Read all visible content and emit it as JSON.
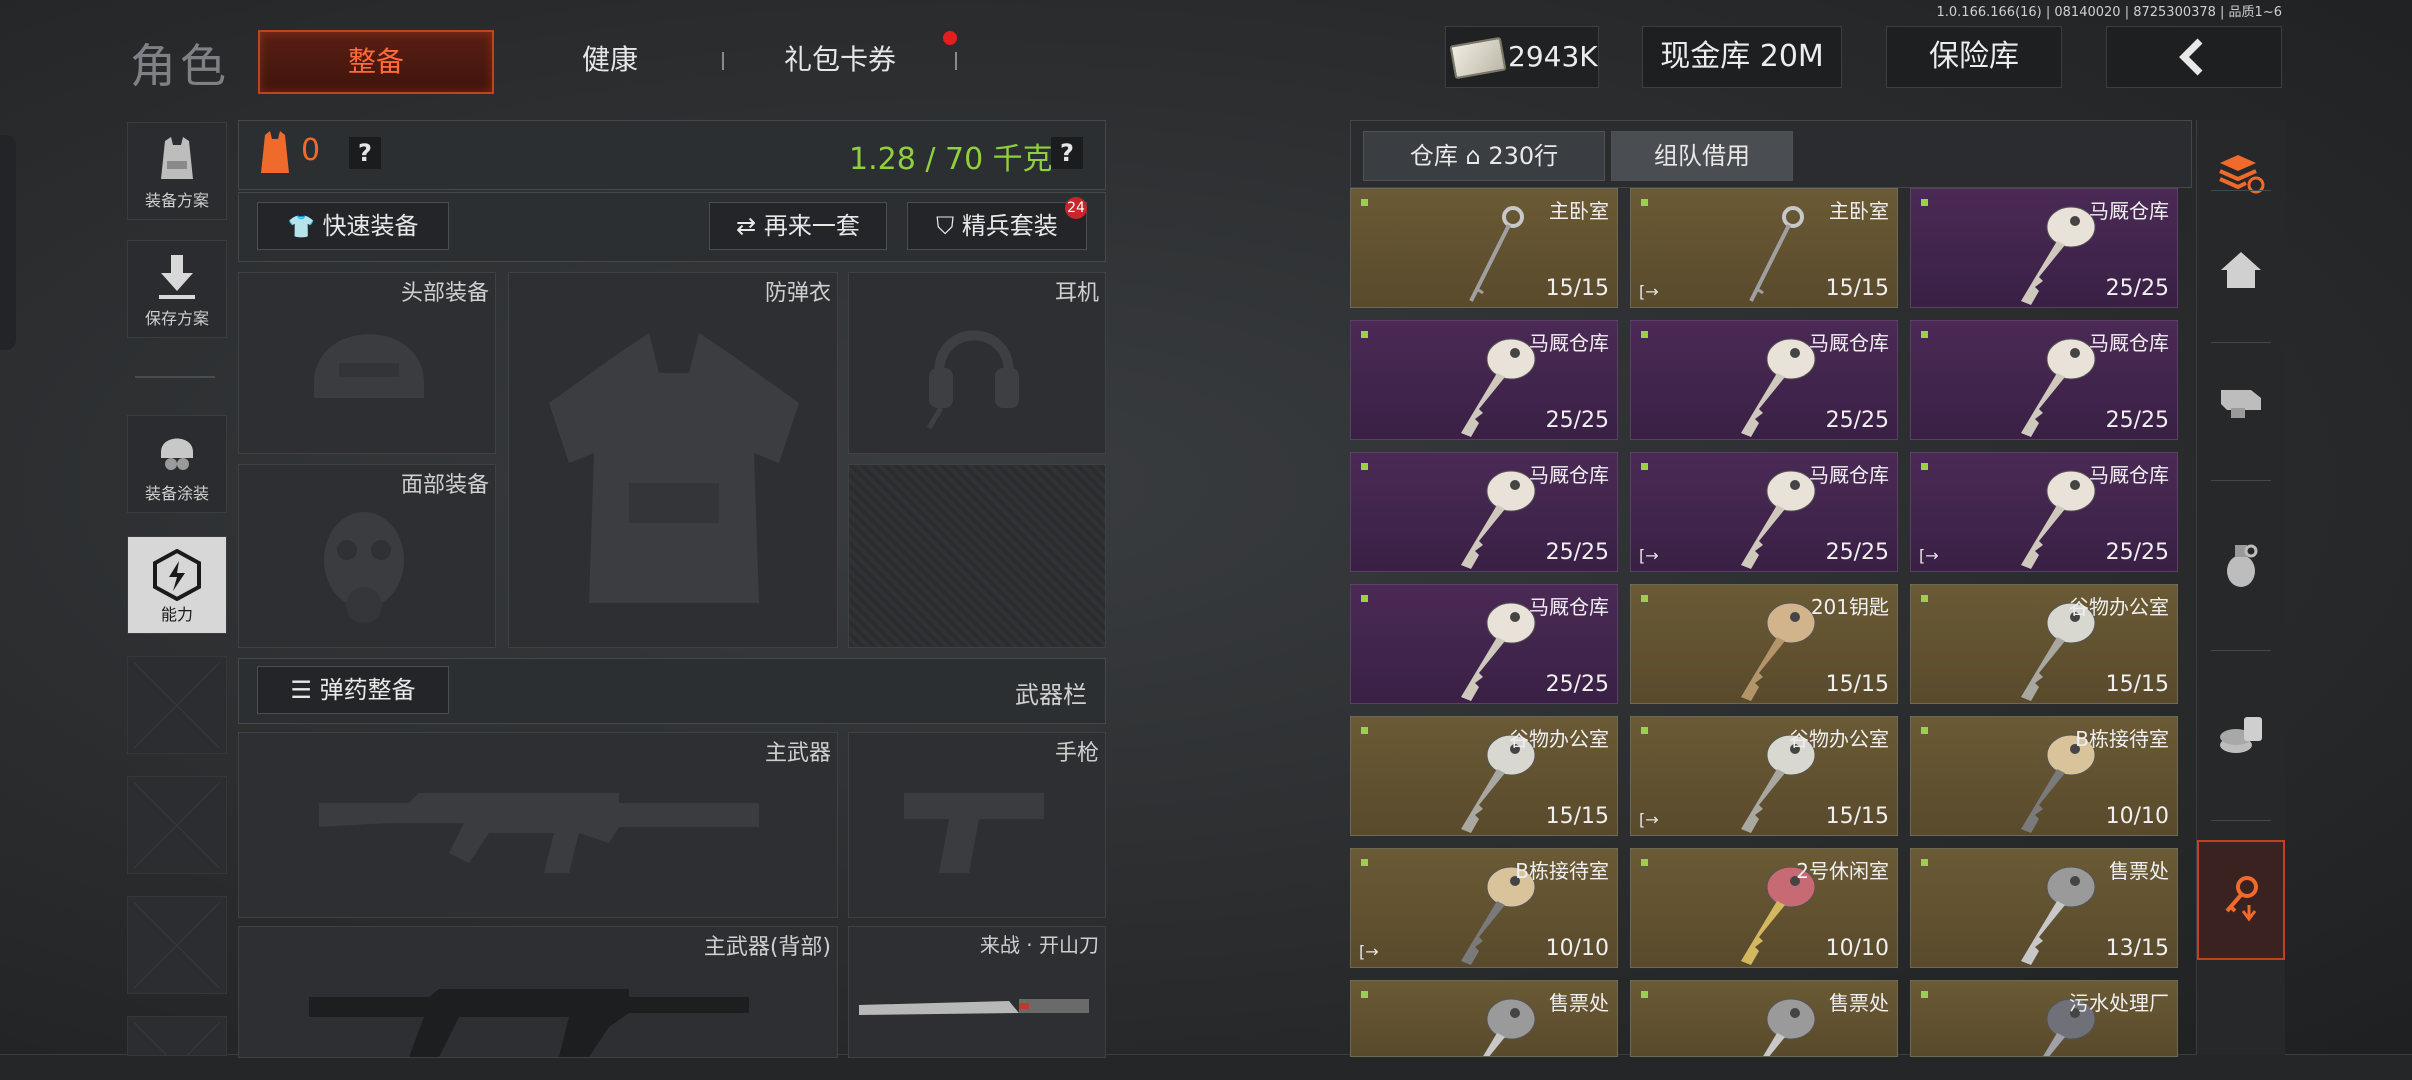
{
  "version": "1.0.166.166(16) | 08140020 | 8725300378 | 品质1~6",
  "header": {
    "title": "角色",
    "tabs": [
      {
        "label": "整备",
        "active": true
      },
      {
        "label": "健康",
        "active": false
      },
      {
        "label": "礼包卡券",
        "active": false,
        "notification": true
      }
    ],
    "currency": "2943K",
    "cash_vault": "现金库 20M",
    "safe_box": "保险库",
    "back_icon": "chevron-left-icon"
  },
  "left_nav": {
    "items": [
      {
        "label": "装备方案",
        "icon": "vest-icon"
      },
      {
        "label": "保存方案",
        "icon": "download-icon"
      },
      {
        "label": "装备涂装",
        "icon": "helmet-icon"
      },
      {
        "label": "能力",
        "icon": "power-hex-icon",
        "active": true
      }
    ]
  },
  "loadout": {
    "armor_count": "0",
    "help": "?",
    "weight": "1.28 / 70 千克",
    "quick_equip": "快速装备",
    "another_set": "再来一套",
    "elite_set": "精兵套装",
    "elite_badge": "24",
    "slots": {
      "head": "头部装备",
      "vest": "防弹衣",
      "headset": "耳机",
      "face": "面部装备"
    },
    "ammo_button": "弹药整备",
    "weapon_bar": "武器栏",
    "primary": "主武器",
    "pistol": "手枪",
    "primary_back": "主武器(背部)",
    "melee": "来战 · 开山刀"
  },
  "inventory": {
    "tab_warehouse": "仓库",
    "warehouse_rows": "230行",
    "tab_team": "组队借用",
    "colors": {
      "gold": "#6a5a35",
      "purple": "#4a2a55",
      "new_dot": "#9ad14b"
    },
    "cards": [
      {
        "name": "主卧室",
        "count": "15/15",
        "rarity": "gold",
        "key": "ring",
        "exit": false
      },
      {
        "name": "主卧室",
        "count": "15/15",
        "rarity": "gold",
        "key": "ring",
        "exit": true
      },
      {
        "name": "马厩仓库",
        "count": "25/25",
        "rarity": "purple",
        "key": "white",
        "exit": false
      },
      {
        "name": "马厩仓库",
        "count": "25/25",
        "rarity": "purple",
        "key": "white",
        "exit": false
      },
      {
        "name": "马厩仓库",
        "count": "25/25",
        "rarity": "purple",
        "key": "white",
        "exit": false
      },
      {
        "name": "马厩仓库",
        "count": "25/25",
        "rarity": "purple",
        "key": "white",
        "exit": false
      },
      {
        "name": "马厩仓库",
        "count": "25/25",
        "rarity": "purple",
        "key": "white",
        "exit": false
      },
      {
        "name": "马厩仓库",
        "count": "25/25",
        "rarity": "purple",
        "key": "white",
        "exit": true
      },
      {
        "name": "马厩仓库",
        "count": "25/25",
        "rarity": "purple",
        "key": "white",
        "exit": true
      },
      {
        "name": "马厩仓库",
        "count": "25/25",
        "rarity": "purple",
        "key": "white",
        "exit": false
      },
      {
        "name": "201钥匙",
        "count": "15/15",
        "rarity": "gold",
        "key": "brass",
        "exit": false
      },
      {
        "name": "谷物办公室",
        "count": "15/15",
        "rarity": "gold",
        "key": "clear",
        "exit": false
      },
      {
        "name": "谷物办公室",
        "count": "15/15",
        "rarity": "gold",
        "key": "clear",
        "exit": false
      },
      {
        "name": "谷物办公室",
        "count": "15/15",
        "rarity": "gold",
        "key": "clear",
        "exit": true
      },
      {
        "name": "B栋接待室",
        "count": "10/10",
        "rarity": "gold",
        "key": "tan",
        "exit": false
      },
      {
        "name": "B栋接待室",
        "count": "10/10",
        "rarity": "gold",
        "key": "tan",
        "exit": true
      },
      {
        "name": "2号休闲室",
        "count": "10/10",
        "rarity": "gold",
        "key": "red",
        "exit": false
      },
      {
        "name": "售票处",
        "count": "13/15",
        "rarity": "gold",
        "key": "grey",
        "exit": false
      },
      {
        "name": "售票处",
        "count": "",
        "rarity": "gold",
        "key": "grey",
        "exit": false
      },
      {
        "name": "售票处",
        "count": "",
        "rarity": "gold",
        "key": "grey",
        "exit": false
      },
      {
        "name": "污水处理厂",
        "count": "",
        "rarity": "gold",
        "key": "darkgrey",
        "exit": false
      }
    ]
  },
  "side_bar": {
    "icons": [
      "layers-refresh-icon",
      "home-icon",
      "scope-icon",
      "grenade-icon",
      "ammo-icon",
      "key-download-icon"
    ],
    "active_index": 5
  }
}
